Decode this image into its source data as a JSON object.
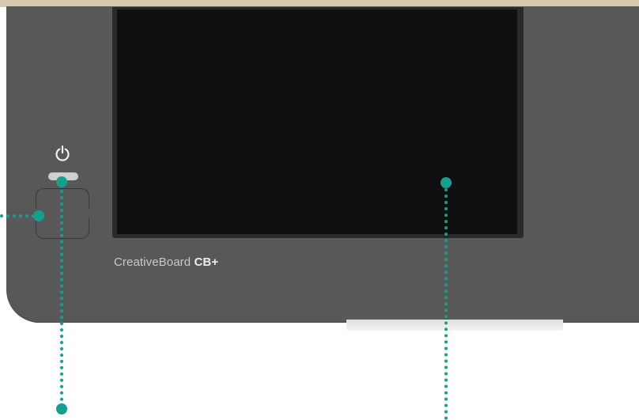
{
  "diagram": {
    "brand": {
      "name": "CreativeBoard",
      "model": "CB+"
    },
    "colors": {
      "device_body": "#585858",
      "screen": "#101010",
      "callout": "#14a08c",
      "brand_text": "#c8c8c8",
      "top_strip": "#d7c8b0"
    },
    "icons": {
      "power": "power-icon"
    },
    "callouts": [
      {
        "target": "power-led"
      },
      {
        "target": "side-button"
      },
      {
        "target": "display-screen"
      }
    ]
  }
}
